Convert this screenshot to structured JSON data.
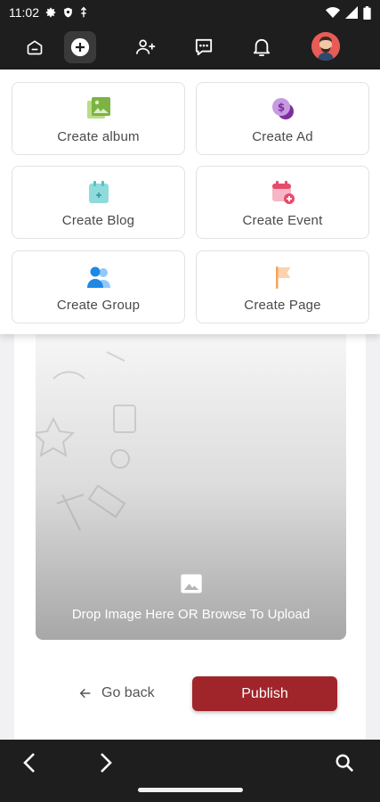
{
  "status_bar": {
    "time": "11:02"
  },
  "create_menu": {
    "items": [
      {
        "label": "Create album",
        "icon": "album-icon",
        "color": "#7cb342"
      },
      {
        "label": "Create Ad",
        "icon": "ad-icon",
        "color": "#8e44ad"
      },
      {
        "label": "Create Blog",
        "icon": "blog-icon",
        "color": "#4fc3c7"
      },
      {
        "label": "Create Event",
        "icon": "event-icon",
        "color": "#e84c6b"
      },
      {
        "label": "Create Group",
        "icon": "group-icon",
        "color": "#42a5f5"
      },
      {
        "label": "Create Page",
        "icon": "page-flag-icon",
        "color": "#f5a25d"
      }
    ]
  },
  "upload": {
    "text": "Drop Image Here OR Browse To Upload"
  },
  "actions": {
    "go_back": "Go back",
    "publish": "Publish"
  },
  "colors": {
    "bar": "#1e1e1e",
    "publish": "#a0252a"
  }
}
